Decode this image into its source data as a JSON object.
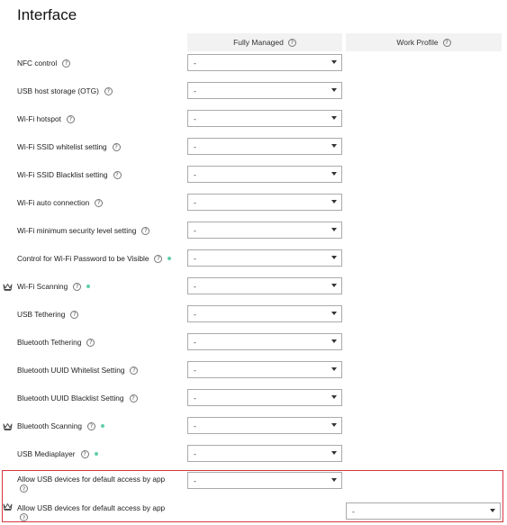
{
  "page": {
    "title": "Interface"
  },
  "columns": [
    {
      "label": "Fully Managed"
    },
    {
      "label": "Work Profile"
    }
  ],
  "help_glyph": "?",
  "crown_icon": "crown-icon",
  "colors": {
    "dot": "#5fcfa8",
    "highlight": "#d9363e"
  },
  "rows": [
    {
      "label": "NFC control",
      "fm_value": "-"
    },
    {
      "label": "USB host storage (OTG)",
      "fm_value": "-"
    },
    {
      "label": "Wi-Fi hotspot",
      "fm_value": "-"
    },
    {
      "label": "Wi-Fi SSID whitelist setting",
      "fm_value": "-"
    },
    {
      "label": "Wi-Fi SSID Blacklist setting",
      "fm_value": "-"
    },
    {
      "label": "Wi-Fi auto connection",
      "fm_value": "-"
    },
    {
      "label": "Wi-Fi minimum security level setting",
      "fm_value": "-"
    },
    {
      "label": "Control for Wi-Fi Password to be Visible",
      "fm_value": "-",
      "dot": true
    },
    {
      "label": "Wi-Fi Scanning",
      "fm_value": "-",
      "dot": true,
      "crown": true
    },
    {
      "label": "USB Tethering",
      "fm_value": "-"
    },
    {
      "label": "Bluetooth Tethering",
      "fm_value": "-"
    },
    {
      "label": "Bluetooth UUID Whitelist Setting",
      "fm_value": "-"
    },
    {
      "label": "Bluetooth UUID Blacklist Setting",
      "fm_value": "-"
    },
    {
      "label": "Bluetooth Scanning",
      "fm_value": "-",
      "dot": true,
      "crown": true
    },
    {
      "label": "USB Mediaplayer",
      "fm_value": "-",
      "dot": true
    }
  ],
  "highlighted_rows": [
    {
      "label": "Allow USB devices for default access by app",
      "fm_value": "-"
    },
    {
      "label": "Allow USB devices for default access by app",
      "wp_value": "-",
      "crown": true
    }
  ]
}
